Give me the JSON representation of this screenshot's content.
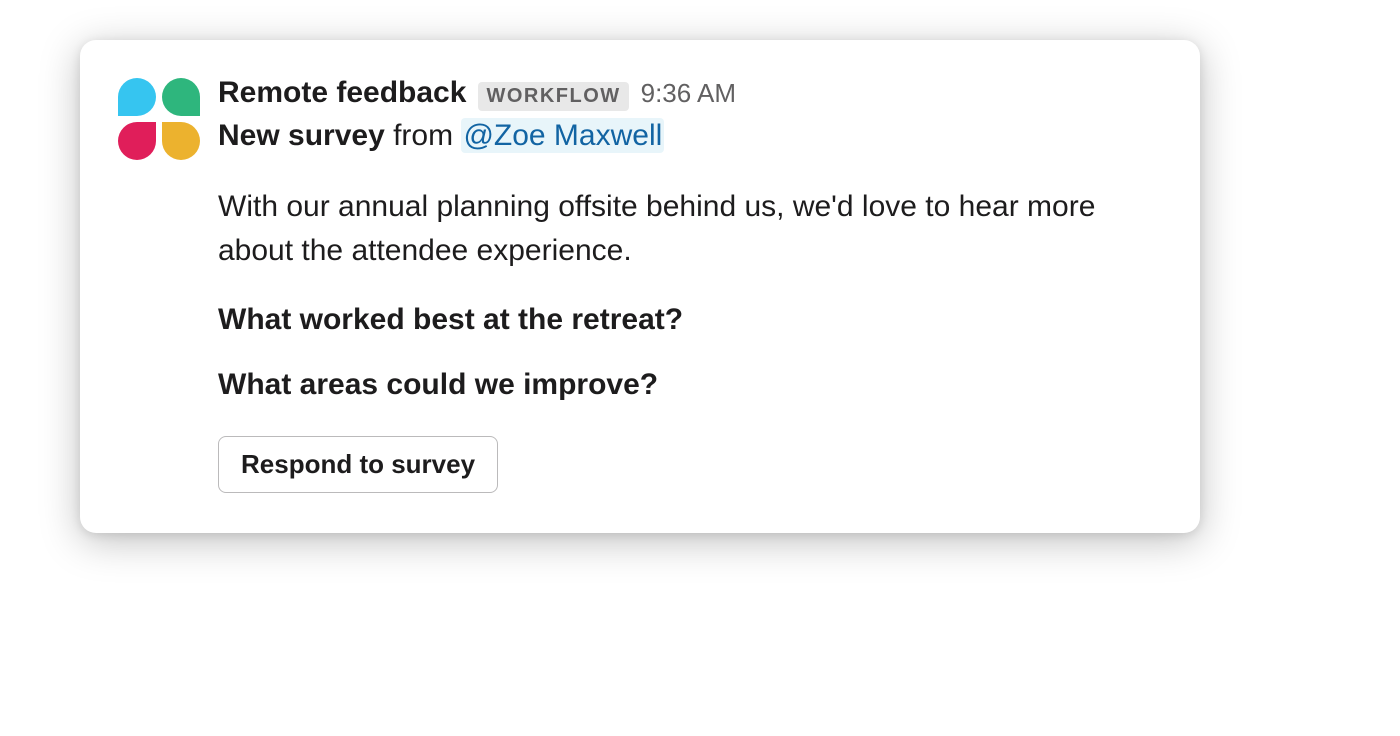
{
  "message": {
    "sender": "Remote feedback",
    "badge": "WORKFLOW",
    "timestamp": "9:36 AM",
    "subtitle_bold": "New survey",
    "subtitle_from": " from ",
    "mention": "@Zoe Maxwell",
    "body": "With our annual planning offsite behind us, we'd love to hear more about the attendee experience.",
    "question1": "What worked best at the retreat?",
    "question2": "What areas could we improve?",
    "button_label": "Respond to survey"
  }
}
